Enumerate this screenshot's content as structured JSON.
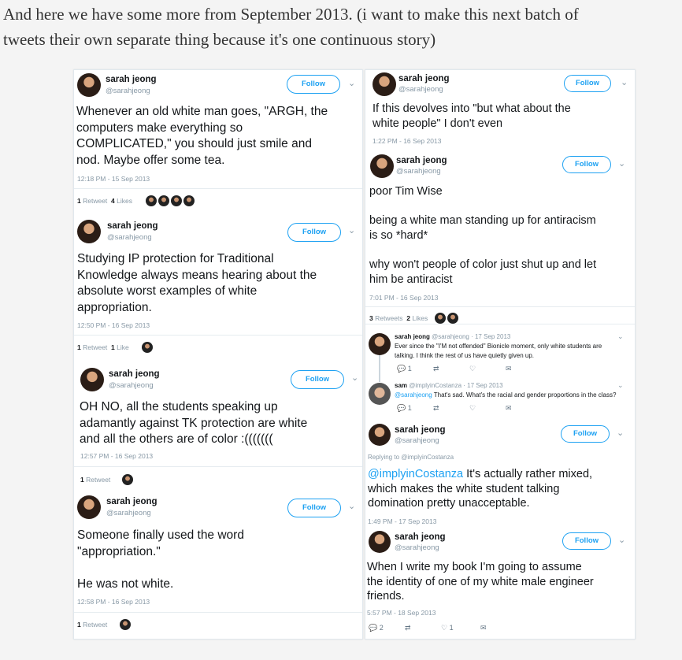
{
  "intro": {
    "line1": "And here we have some more from September 2013. (i want to make this next batch of",
    "line2": "tweets their own separate thing because it's one continuous story)"
  },
  "follow_label": "Follow",
  "left": [
    {
      "name": "sarah jeong",
      "handle": "@sarahjeong",
      "lines": [
        "Whenever an old white man goes, \"ARGH, the",
        "computers make everything so",
        "COMPLICATED,\" you should just smile and",
        "nod. Maybe offer some tea."
      ],
      "time": "12:18 PM - 15 Sep 2013",
      "retweets": "1",
      "retweets_label": "Retweet",
      "likes": "4",
      "likes_label": "Likes"
    },
    {
      "name": "sarah jeong",
      "handle": "@sarahjeong",
      "lines": [
        "Studying IP protection for Traditional",
        "Knowledge always means hearing about the",
        "absolute worst examples of white",
        "appropriation."
      ],
      "time": "12:50 PM - 16 Sep 2013",
      "retweets": "1",
      "retweets_label": "Retweet",
      "likes": "1",
      "likes_label": "Like"
    },
    {
      "name": "sarah jeong",
      "handle": "@sarahjeong",
      "lines": [
        "OH NO, all the students speaking up",
        "adamantly against TK protection are white",
        "and all the others are of color :(((((((",
        ""
      ],
      "time": "12:57 PM - 16 Sep 2013",
      "retweets": "1",
      "retweets_label": "Retweet"
    },
    {
      "name": "sarah jeong",
      "handle": "@sarahjeong",
      "lines": [
        "Someone finally used the word",
        "\"appropriation.\"",
        "",
        "He was not white."
      ],
      "time": "12:58 PM - 16 Sep 2013",
      "retweets": "1",
      "retweets_label": "Retweet"
    }
  ],
  "right": {
    "t1": {
      "name": "sarah jeong",
      "handle": "@sarahjeong",
      "lines": [
        "If this devolves into \"but what about the",
        "white people\" I don't even"
      ],
      "time": "1:22 PM - 16 Sep 2013"
    },
    "t2": {
      "name": "sarah jeong",
      "handle": "@sarahjeong",
      "para1": "poor Tim Wise",
      "para2": [
        "being a white man standing up for antiracism",
        "is so *hard*"
      ],
      "para3": [
        "why won't people of color just shut up and let",
        "him be antiracist"
      ],
      "time": "7:01 PM - 16 Sep 2013",
      "retweets": "3",
      "retweets_label": "Retweets",
      "likes": "2",
      "likes_label": "Likes"
    },
    "reply1": {
      "name": "sarah jeong",
      "handle": "@sarahjeong",
      "date": "· 17 Sep 2013",
      "lines": [
        "Ever since the \"I'M not offended\" Bionicle moment, only white students are",
        "talking. I think the rest of us have quietly given up."
      ],
      "replies": "1"
    },
    "reply2": {
      "name": "sam",
      "handle": "@implyinCostanza",
      "date": "· 17 Sep 2013",
      "mention": "@sarahjeong",
      "text": " That's sad. What's the racial and gender proportions in the class?",
      "replies": "1"
    },
    "t3": {
      "name": "sarah jeong",
      "handle": "@sarahjeong",
      "replying": "Replying to @implyinCostanza",
      "mention": "@implyinCostanza",
      "line1_rest": " It's actually rather mixed,",
      "lines": [
        "which makes the white student talking",
        "domination pretty unacceptable."
      ],
      "time": "1:49 PM - 17 Sep 2013"
    },
    "t4": {
      "name": "sarah jeong",
      "handle": "@sarahjeong",
      "lines": [
        "When I write my book I'm going to assume",
        "the identity of one of my white male engineer",
        "friends."
      ],
      "time": "5:57 PM - 18 Sep 2013",
      "replies": "2",
      "likes": "1"
    }
  }
}
